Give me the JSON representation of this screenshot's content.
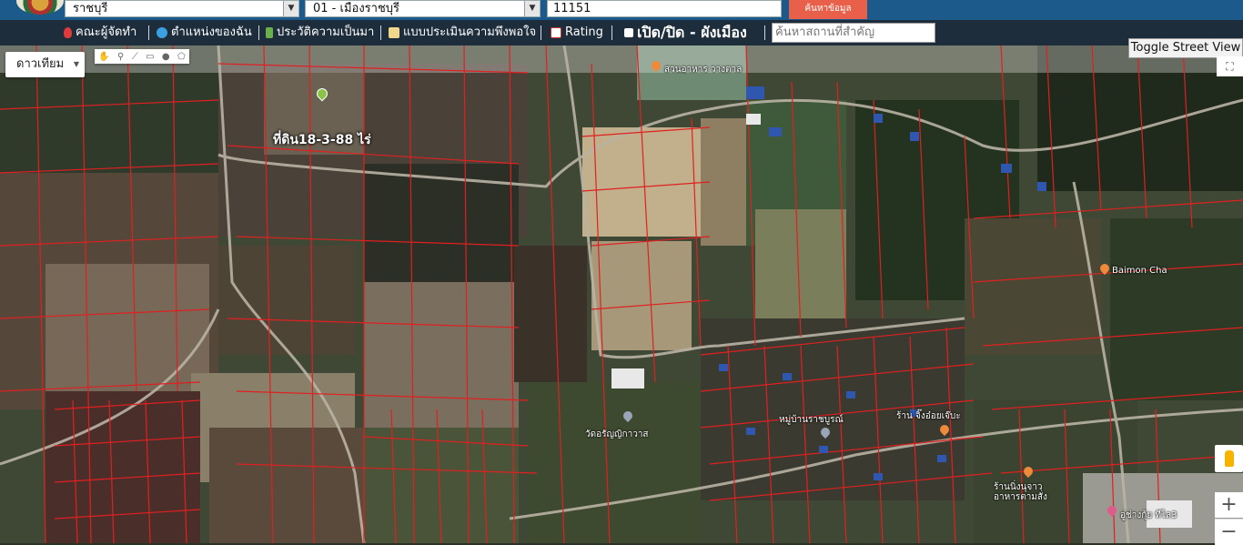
{
  "filters": {
    "province": "ราชบุรี",
    "district": "01 - เมืองราชบุรี",
    "postcode": "11151",
    "search_button": "ค้นหาข้อมูล"
  },
  "nav": {
    "items": [
      "คณะผู้จัดทำ",
      "ตำแหน่งของฉัน",
      "ประวัติความเป็นมา",
      "แบบประเมินความพึงพอใจ",
      "Rating"
    ],
    "toggle_label": "เปิด/ปิด - ผังเมือง",
    "place_search_placeholder": "ค้นหาสถานที่สำคัญ"
  },
  "map": {
    "map_type": "ดาวเทียม",
    "street_view_button": "Toggle Street View",
    "parcel_label": "ที่ดิน18-3-88 ไร่",
    "zoom_in": "+",
    "zoom_out": "−",
    "pois": [
      "สวนอาหาร วางตาล",
      "Baimon Cha",
      "วัดอรัญญิกาวาส",
      "หมู่บ้านราชบูรณ์",
      "ร้าน จิ๊งอ๋อยเจ๊บะ",
      "ร้านนิ่งนุจาว อาหารตามสั่ง",
      "อู่ช่างกุ้ย ทีไล3"
    ]
  },
  "colors": {
    "header_bg": "#1b5a8a",
    "nav_bg": "#1d2d3c",
    "search_button_bg": "#e8604a",
    "parcel_line": "#e02020"
  }
}
